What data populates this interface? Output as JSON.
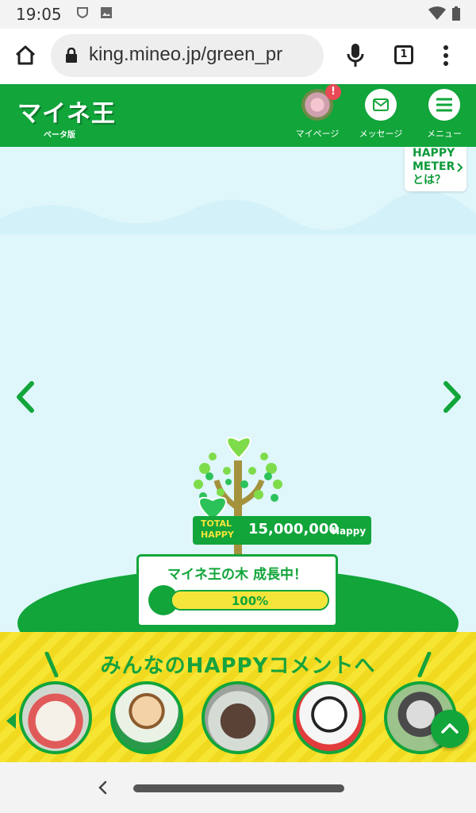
{
  "status_bar": {
    "time": "19:05",
    "icons": [
      "shield-icon",
      "image-icon",
      "wifi-icon",
      "battery-icon"
    ]
  },
  "browser": {
    "url": "king.mineo.jp/green_pr",
    "tab_count": "1",
    "icons": [
      "home-icon",
      "lock-icon",
      "mic-icon",
      "tabs-icon",
      "overflow-menu-icon"
    ]
  },
  "header": {
    "logo_text": "マイネ王",
    "beta_label": "ベータ版",
    "nav": [
      {
        "label": "マイページ",
        "badge": "!"
      },
      {
        "label": "メッセージ"
      },
      {
        "label": "メニュー"
      }
    ]
  },
  "happy_meter": {
    "line1": "HAPPY",
    "line2": "METER",
    "line3": "とは？"
  },
  "tree": {
    "total_label_1": "TOTAL",
    "total_label_2": "HAPPY",
    "total_value": "15,000,000",
    "total_unit": "Happy",
    "growth_title": "マイネ王の木 成長中！",
    "progress_text": "100%",
    "progress": 1.0
  },
  "comments": {
    "title": "みんなのHAPPYコメントへ"
  },
  "colors": {
    "brand_green": "#11a53a",
    "sky": "#dff6fb",
    "band_yellow": "#f7e533",
    "badge_red": "#e94a55"
  }
}
